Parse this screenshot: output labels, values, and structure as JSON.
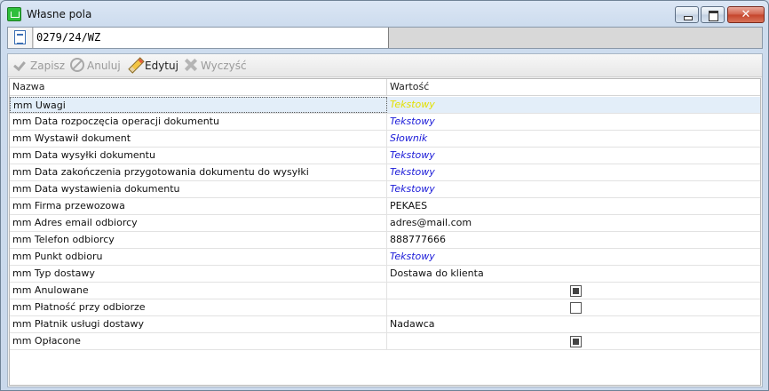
{
  "window": {
    "title": "Własne pola"
  },
  "document": {
    "number": "0279/24/WZ"
  },
  "toolbar": {
    "save_label": "Zapisz",
    "cancel_label": "Anuluj",
    "edit_label": "Edytuj",
    "clear_label": "Wyczyść"
  },
  "grid": {
    "columns": [
      "Nazwa",
      "Wartość"
    ],
    "rows": [
      {
        "name": "mm Uwagi",
        "value": "Tekstowy",
        "kind": "type"
      },
      {
        "name": "mm Data rozpoczęcia operacji dokumentu",
        "value": "Tekstowy",
        "kind": "type"
      },
      {
        "name": "mm Wystawił dokument",
        "value": "Słownik",
        "kind": "type"
      },
      {
        "name": "mm Data wysyłki dokumentu",
        "value": "Tekstowy",
        "kind": "type"
      },
      {
        "name": "mm Data zakończenia przygotowania dokumentu do wysyłki",
        "value": "Tekstowy",
        "kind": "type"
      },
      {
        "name": "mm Data wystawienia dokumentu",
        "value": "Tekstowy",
        "kind": "type"
      },
      {
        "name": "mm Firma przewozowa",
        "value": "PEKAES",
        "kind": "text"
      },
      {
        "name": "mm Adres email odbiorcy",
        "value": "adres@mail.com",
        "kind": "text"
      },
      {
        "name": "mm Telefon odbiorcy",
        "value": "888777666",
        "kind": "text"
      },
      {
        "name": "mm Punkt odbioru",
        "value": "Tekstowy",
        "kind": "type"
      },
      {
        "name": "mm Typ dostawy",
        "value": "Dostawa do klienta",
        "kind": "text"
      },
      {
        "name": "mm Anulowane",
        "checked": true,
        "kind": "checkbox"
      },
      {
        "name": "mm Płatność przy odbiorze",
        "checked": false,
        "kind": "checkbox"
      },
      {
        "name": "mm Płatnik usługi dostawy",
        "value": "Nadawca",
        "kind": "text"
      },
      {
        "name": "mm Opłacone",
        "checked": true,
        "kind": "checkbox"
      }
    ]
  },
  "colors": {
    "type_value": "#1a1ad8",
    "selected_type_value": "#e3e000",
    "selected_row_bg": "#e3eef9"
  }
}
